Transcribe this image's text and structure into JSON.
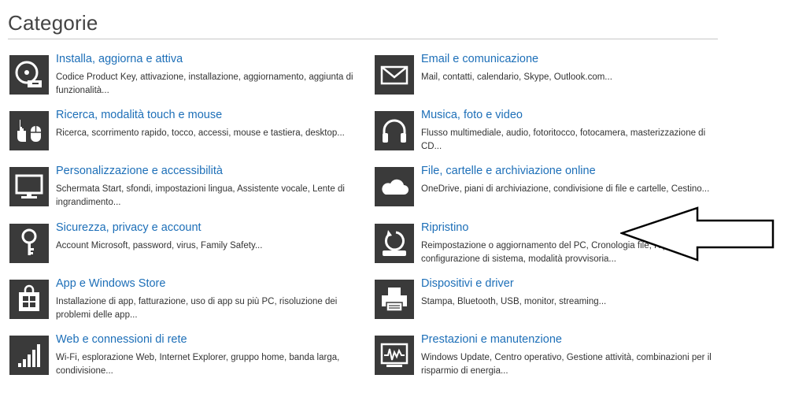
{
  "page": {
    "title": "Categorie"
  },
  "colors": {
    "link": "#1d6fb8",
    "icon_bg": "#3a3a3a",
    "text": "#333333"
  },
  "categories": [
    {
      "icon": "disc-drive-icon",
      "title": "Installa, aggiorna e attiva",
      "desc": "Codice Product Key, attivazione, installazione, aggiornamento, aggiunta di funzionalità..."
    },
    {
      "icon": "envelope-icon",
      "title": "Email e comunicazione",
      "desc": "Mail, contatti, calendario, Skype, Outlook.com..."
    },
    {
      "icon": "touch-mouse-icon",
      "title": "Ricerca, modalità touch e mouse",
      "desc": "Ricerca, scorrimento rapido, tocco, accessi, mouse e tastiera, desktop..."
    },
    {
      "icon": "headphones-icon",
      "title": "Musica, foto e video",
      "desc": "Flusso multimediale, audio, fotoritocco, fotocamera, masterizzazione di CD..."
    },
    {
      "icon": "monitor-icon",
      "title": "Personalizzazione e accessibilità",
      "desc": "Schermata Start, sfondi, impostazioni lingua, Assistente vocale, Lente di ingrandimento..."
    },
    {
      "icon": "cloud-icon",
      "title": "File, cartelle e archiviazione online",
      "desc": "OneDrive, piani di archiviazione, condivisione di file e cartelle, Cestino..."
    },
    {
      "icon": "key-icon",
      "title": "Sicurezza, privacy e account",
      "desc": "Account Microsoft, password, virus, Family Safety..."
    },
    {
      "icon": "restore-icon",
      "title": "Ripristino",
      "desc": "Reimpostazione o aggiornamento del PC, Cronologia file, Ripristino configurazione di sistema, modalità provvisoria..."
    },
    {
      "icon": "store-bag-icon",
      "title": "App e Windows Store",
      "desc": "Installazione di app, fatturazione, uso di app su più PC, risoluzione dei problemi delle app..."
    },
    {
      "icon": "printer-icon",
      "title": "Dispositivi e driver",
      "desc": "Stampa, Bluetooth, USB, monitor, streaming..."
    },
    {
      "icon": "signal-bars-icon",
      "title": "Web e connessioni di rete",
      "desc": "Wi-Fi, esplorazione Web, Internet Explorer, gruppo home, banda larga, condivisione..."
    },
    {
      "icon": "performance-monitor-icon",
      "title": "Prestazioni e manutenzione",
      "desc": "Windows Update, Centro operativo, Gestione attività, combinazioni per il risparmio di energia..."
    }
  ]
}
